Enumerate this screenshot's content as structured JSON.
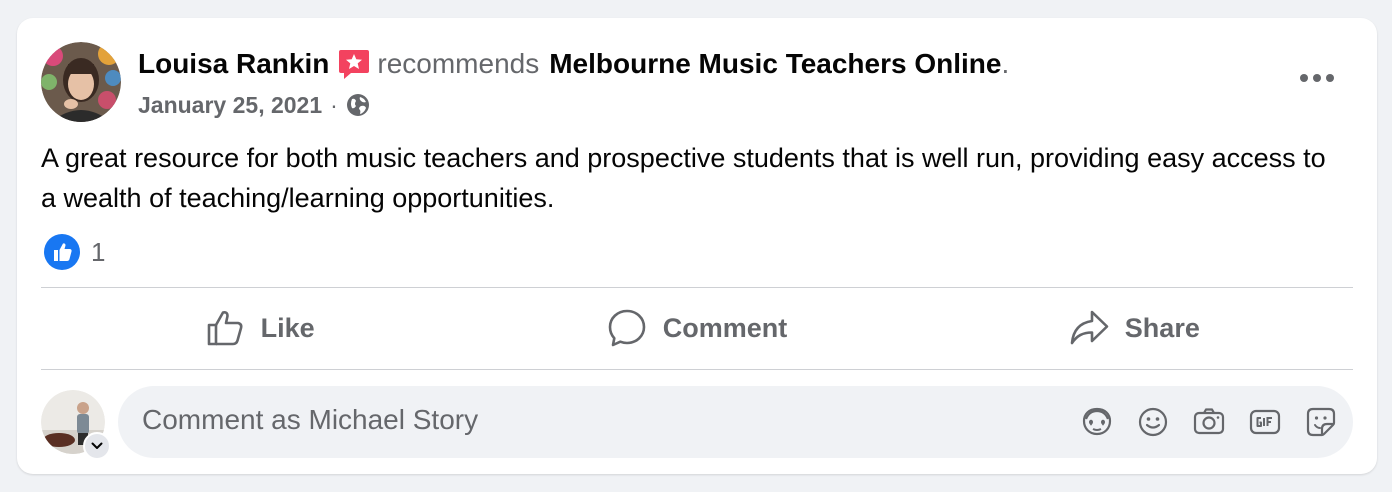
{
  "post": {
    "author_name": "Louisa Rankin",
    "recommends_text": "recommends",
    "page_name": "Melbourne Music Teachers Online",
    "period": ".",
    "date": "January 25, 2021",
    "separator": "·",
    "audience_icon": "globe-icon",
    "body": "A great resource for both music teachers and prospective students that is well run, providing easy access to a wealth of teaching/learning opportunities.",
    "reaction_icon": "like-reaction-icon",
    "reaction_count": "1"
  },
  "actions": {
    "like_label": "Like",
    "comment_label": "Comment",
    "share_label": "Share"
  },
  "composer": {
    "placeholder": "Comment as Michael Story",
    "icons": [
      "avatar-sticker-icon",
      "emoji-icon",
      "camera-icon",
      "gif-icon",
      "sticker-icon"
    ]
  },
  "colors": {
    "background": "#f0f2f5",
    "card": "#ffffff",
    "primary_text": "#050505",
    "secondary_text": "#65676b",
    "like_blue": "#1877f2",
    "recommend_red": "#f3425f",
    "divider": "#ced0d4"
  }
}
